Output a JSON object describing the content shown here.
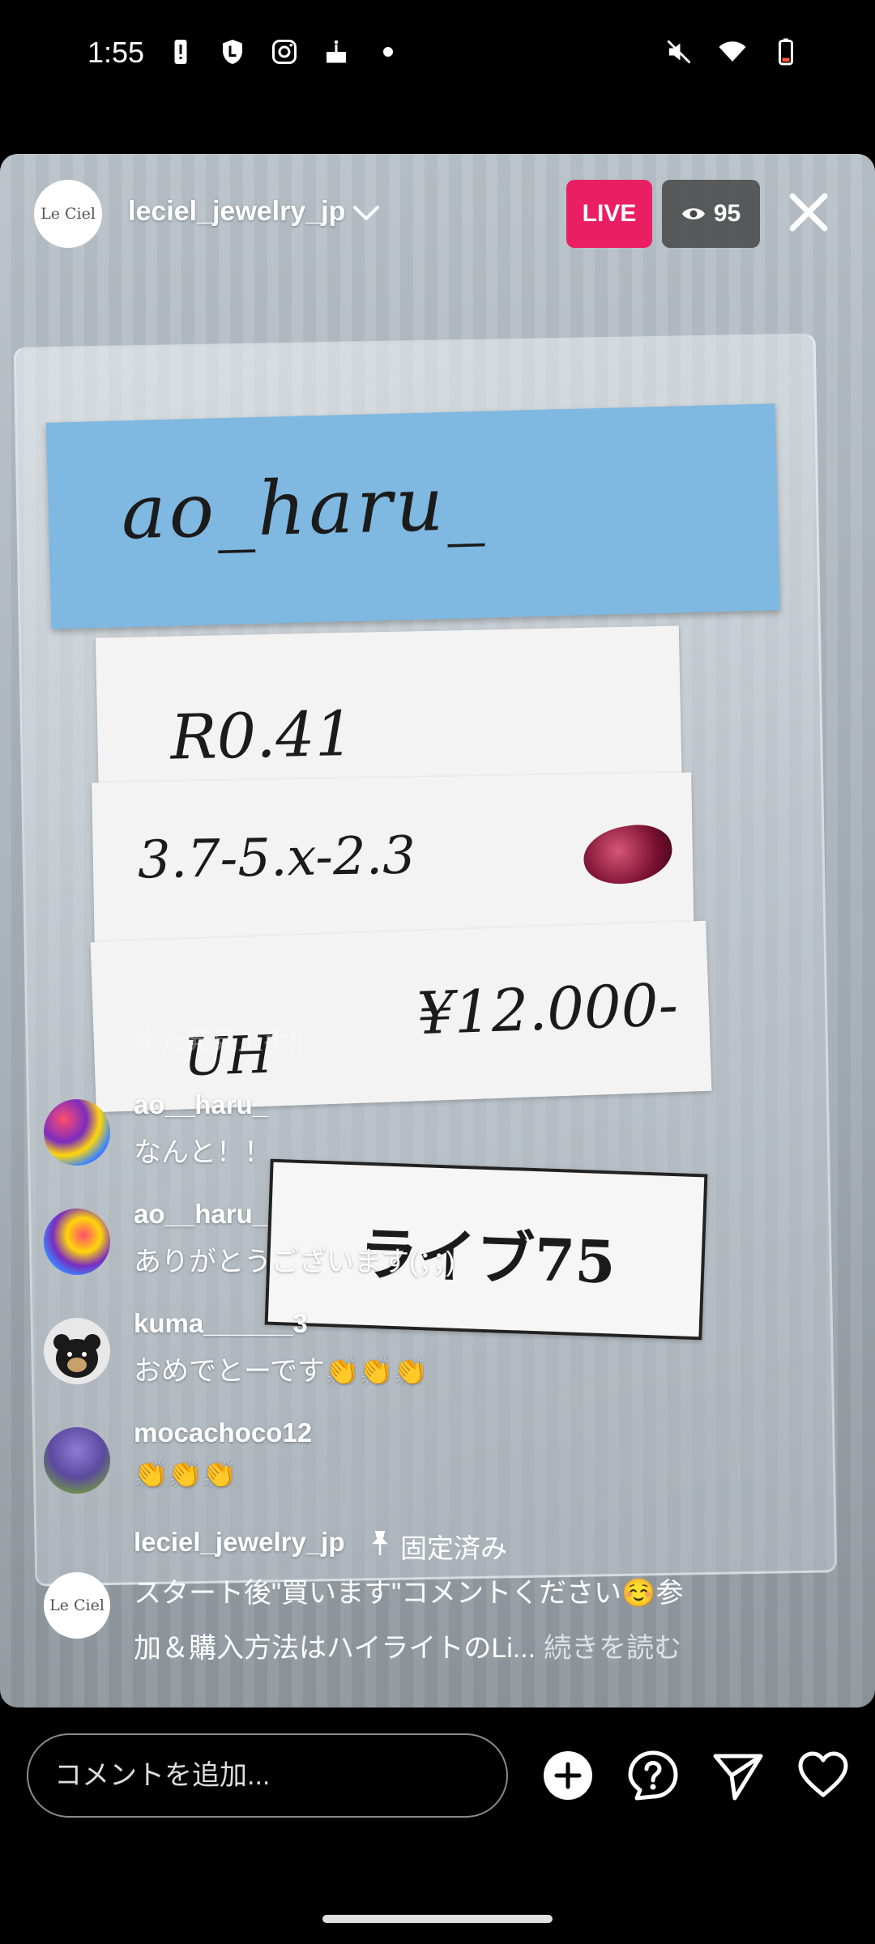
{
  "status_bar": {
    "time": "1:55",
    "left_icons": [
      "battery-alert-icon",
      "lock-shield-icon",
      "instagram-icon",
      "cake-icon",
      "dot-icon"
    ],
    "right_icons": [
      "mute-icon",
      "wifi-icon",
      "battery-icon"
    ]
  },
  "live": {
    "host_avatar_text": "Le Ciel",
    "host_username": "leciel_jewelry_jp",
    "live_label": "LIVE",
    "viewer_count": "95",
    "accent_color": "#e91e63"
  },
  "video": {
    "label_name": "ao_haru_",
    "label_line1": "R0.41",
    "label_line2": "3.7-5.x-2.3",
    "label_line3_left": "UH",
    "label_line3_right": "¥12.000-",
    "label_live_tag": "ライブ75"
  },
  "comments": {
    "faded": "また発見上手!!",
    "items": [
      {
        "username": "ao__haru_",
        "text": "なんと！！"
      },
      {
        "username": "ao__haru_",
        "text": "ありがとうございます(；；)"
      },
      {
        "username": "kuma______3",
        "text": "おめでとーです👏👏👏"
      },
      {
        "username": "mocachoco12",
        "text": "👏👏👏"
      }
    ],
    "pinned": {
      "avatar_text": "Le Ciel",
      "username": "leciel_jewelry_jp",
      "pinned_label": "固定済み",
      "line1": "スタート後\"買います\"コメントください☺️参",
      "line2": "加＆購入方法はハイライトのLi...",
      "read_more": "続きを読む"
    }
  },
  "bottom_bar": {
    "comment_placeholder": "コメントを追加...",
    "icons": [
      "add-icon",
      "question-icon",
      "send-icon",
      "heart-icon"
    ]
  }
}
